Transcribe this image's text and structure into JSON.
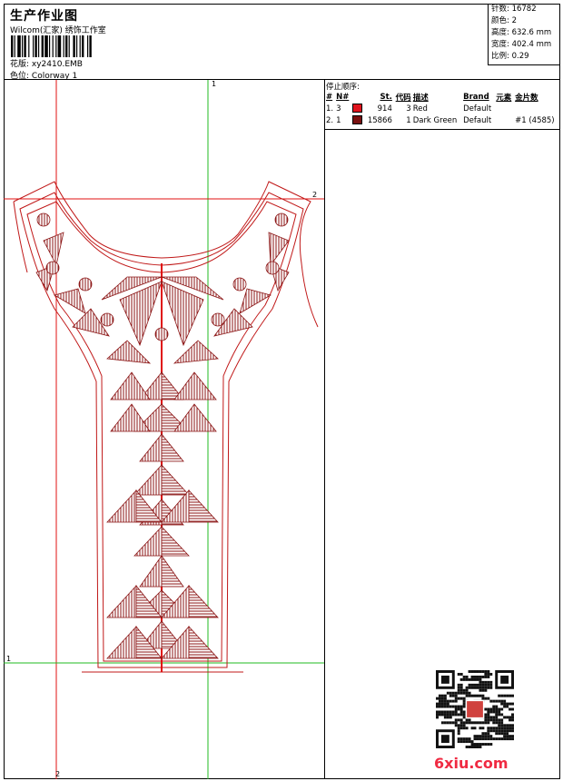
{
  "header": {
    "title": "生产作业图",
    "company": "Wilcom(汇家) 绣饰工作室",
    "design_label": "花版: ",
    "design_value": "xy2410.EMB",
    "colorway_label": "色位: ",
    "colorway_value": "Colorway 1"
  },
  "stats": [
    {
      "label": "针数: ",
      "value": "16782"
    },
    {
      "label": "颜色: ",
      "value": "2"
    },
    {
      "label": "高度: ",
      "value": "632.6 mm"
    },
    {
      "label": "宽度: ",
      "value": "402.4 mm"
    },
    {
      "label": "比例: ",
      "value": "0.29"
    }
  ],
  "stop_sequence": {
    "title": "停止顺序:",
    "headers": [
      "#",
      "N#",
      "",
      "St.",
      "代码",
      "描述",
      "Brand",
      "元素",
      "金片数"
    ],
    "rows": [
      {
        "num": "1.",
        "n": "3",
        "swatch": "#e0141e",
        "st": "914",
        "code": "3",
        "desc": "Red",
        "brand": "Default",
        "elem": "",
        "sequin": ""
      },
      {
        "num": "2.",
        "n": "1",
        "swatch": "#7a1010",
        "st": "15866",
        "code": "1",
        "desc": "Dark Green",
        "brand": "Default",
        "elem": "",
        "sequin": "#1 (4585)"
      }
    ]
  },
  "guides": {
    "v1": "1",
    "v2": "2",
    "h1": "1",
    "h2": "2"
  },
  "watermark": "6xiu.com",
  "colors": {
    "red": "#e0141e",
    "dark": "#8b1414",
    "guide_red": "#e01010",
    "guide_green": "#22bb22"
  }
}
